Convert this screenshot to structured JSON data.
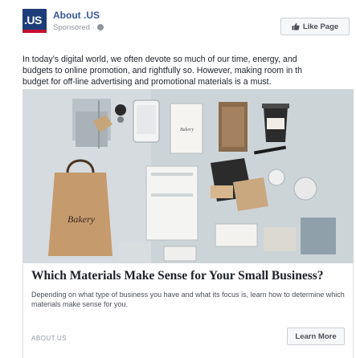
{
  "header": {
    "logo_text": ".US",
    "page_name": "About .US",
    "sponsored": "Sponsored ·",
    "like_button": "Like Page"
  },
  "post": {
    "lines": [
      "In today's digital world, we often devote so much of our time, energy, and",
      "budgets to online promotion, and rightfully so. However, making room in th",
      "budget for off-line advertising and promotional materials is a must."
    ]
  },
  "image": {
    "bag_label": "Bakery",
    "card_label": "Bakery"
  },
  "link": {
    "headline": "Which Materials Make Sense for Your Small Business?",
    "description": "Depending on what type of business you have and what its focus is, learn how to determine which materials make sense for you.",
    "domain": "ABOUT.US",
    "cta": "Learn More"
  },
  "colors": {
    "brand_blue": "#1c3d7a",
    "brand_red": "#c8102e",
    "link_blue": "#365899"
  }
}
